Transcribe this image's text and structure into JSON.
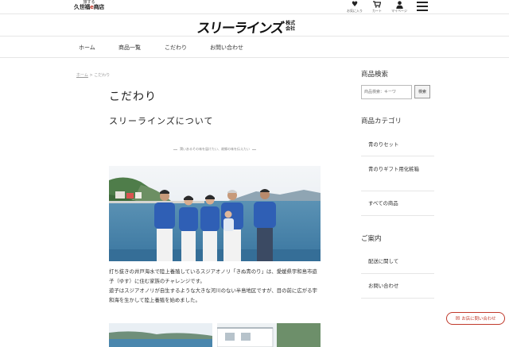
{
  "topbar": {
    "shop_small": "旅する",
    "shop_name_a": "久世福",
    "shop_name_mark": "e",
    "shop_name_b": "商店",
    "favorites_label": "お気に入り",
    "cart_label": "カート",
    "mypage_label": "マイページ"
  },
  "brand": {
    "logo_text": "スリーラインズ",
    "corp_line1": "株式",
    "corp_line2": "会社"
  },
  "nav": {
    "items": [
      "ホーム",
      "商品一覧",
      "こだわり",
      "お問い合わせ"
    ]
  },
  "breadcrumb": {
    "home": "ホーム",
    "separator": " > ",
    "current": "こだわり"
  },
  "main": {
    "title": "こだわり",
    "subtitle": "スリーラインズについて",
    "tagline": "潤いあるその味を届けたい、故郷の味を伝えたい",
    "para1": "打ち抜きの井戸海水で陸上養殖しているスジアオノリ「きぬ青のり」は、愛媛県宇和島市遊子（ゆす）に住む家族のチャレンジです。",
    "para2": "遊子はスジアオノリが自生するような大きな河川のない半島地区ですが、目の前に広がる宇和海を生かして陸上養殖を始めました。"
  },
  "sidebar": {
    "search_heading": "商品検索",
    "search_placeholder": "商品検索：キーワ",
    "search_button": "検索",
    "category_heading": "商品カテゴリ",
    "categories": [
      "青のりセット",
      "青のりギフト用化粧箱",
      "すべての商品"
    ],
    "guide_heading": "ご案内",
    "guides": [
      "配送に関して",
      "お問い合わせ"
    ]
  },
  "floating": {
    "contact_label": "お店に問い合わせ"
  },
  "colors": {
    "accent_red": "#c0392b",
    "divider": "#e6e6e6",
    "shirt_blue": "#2f5fb5"
  }
}
